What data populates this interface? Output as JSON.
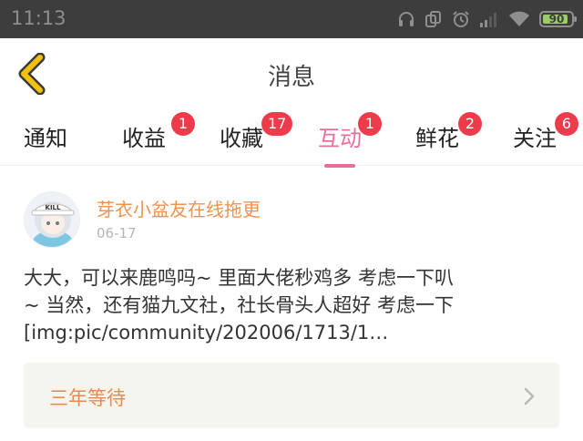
{
  "status_bar": {
    "time": "11:13",
    "battery": "90",
    "battery_level": 0.9,
    "icons": [
      "headset-icon",
      "dual-sim-icon",
      "alarm-icon",
      "signal-icon",
      "wifi-icon",
      "battery-icon"
    ]
  },
  "header": {
    "title": "消息",
    "back_icon": "chevron-left-icon"
  },
  "tabs": [
    {
      "label": "通知",
      "badge": ""
    },
    {
      "label": "收益",
      "badge": "1"
    },
    {
      "label": "收藏",
      "badge": "17"
    },
    {
      "label": "互动",
      "badge": "1",
      "active": true
    },
    {
      "label": "鲜花",
      "badge": "2"
    },
    {
      "label": "关注",
      "badge": "6"
    }
  ],
  "message": {
    "author": "芽衣小盆友在线拖更",
    "date": "06-17",
    "avatar_text": "KILL",
    "body_lines": [
      "大大，可以来鹿鸣吗~ 里面大佬秒鸡多 考虑一下叭",
      "~ 当然，还有猫九文社，社长骨头人超好 考虑一下",
      "[img:pic/community/202006/1713/1…"
    ],
    "reference_title": "三年等待"
  },
  "colors": {
    "accent": "#e86d9c",
    "author": "#f0924f",
    "badge": "#ee3b4b",
    "back_icon": "#f4c20d",
    "status_bar": "#3d3d3d"
  }
}
